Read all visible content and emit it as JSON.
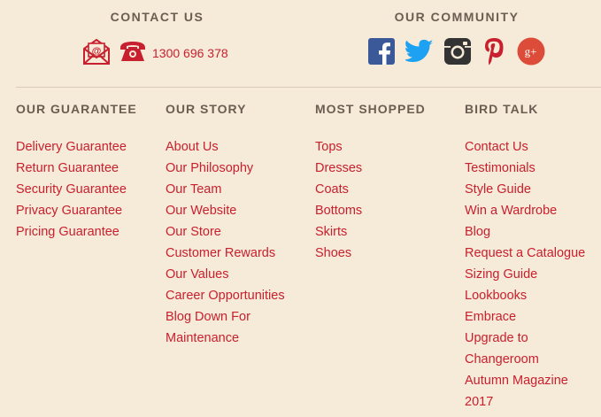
{
  "contact": {
    "heading": "CONTACT US",
    "phone": "1300 696 378",
    "icons": [
      "email-icon",
      "phone-icon"
    ]
  },
  "community": {
    "heading": "OUR COMMUNITY",
    "icons": [
      "facebook-icon",
      "twitter-icon",
      "instagram-icon",
      "pinterest-icon",
      "google-plus-icon"
    ]
  },
  "colors": {
    "accent": "#c8202f",
    "heading": "#6b5d52",
    "background": "#f6ead8",
    "facebook": "#3b5998",
    "twitter": "#1da1f2",
    "instagram": "#333333",
    "pinterest": "#c8202f",
    "google_plus": "#dd4b39"
  },
  "columns": [
    {
      "heading": "OUR GUARANTEE",
      "links": [
        "Delivery Guarantee",
        "Return Guarantee",
        "Security Guarantee",
        "Privacy Guarantee",
        "Pricing Guarantee"
      ]
    },
    {
      "heading": "OUR STORY",
      "links": [
        "About Us",
        "Our Philosophy",
        "Our Team",
        "Our Website",
        "Our Store",
        "Customer Rewards",
        "Our Values",
        "Career Opportunities",
        "Blog Down For Maintenance"
      ]
    },
    {
      "heading": "MOST SHOPPED",
      "links": [
        "Tops",
        "Dresses",
        "Coats",
        "Bottoms",
        "Skirts",
        "Shoes"
      ]
    },
    {
      "heading": "BIRD TALK",
      "links": [
        "Contact Us",
        "Testimonials",
        "Style Guide",
        "Win a Wardrobe",
        "Blog",
        "Request a Catalogue",
        "Sizing Guide",
        "Lookbooks",
        "Embrace",
        "Upgrade to Changeroom",
        "Autumn Magazine 2017"
      ]
    }
  ]
}
